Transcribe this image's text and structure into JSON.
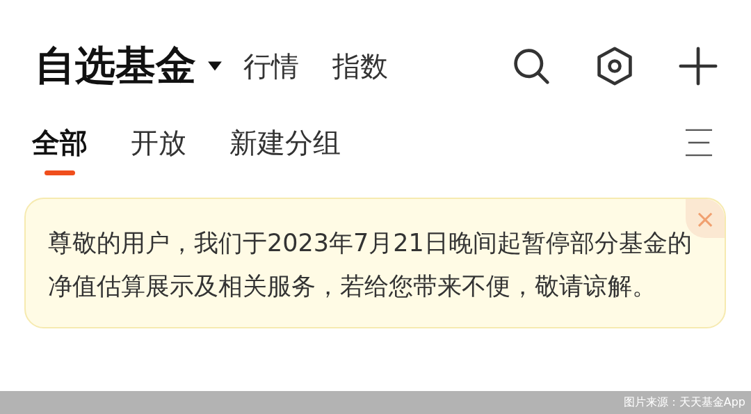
{
  "header": {
    "title": "自选基金",
    "nav": [
      {
        "label": "行情"
      },
      {
        "label": "指数"
      }
    ]
  },
  "tabs": [
    {
      "label": "全部",
      "selected": true
    },
    {
      "label": "开放",
      "selected": false
    },
    {
      "label": "新建分组",
      "selected": false
    }
  ],
  "notice": {
    "text": "尊敬的用户，我们于2023年7月21日晚间起暂停部分基金的净值估算展示及相关服务，若给您带来不便，敬请谅解。",
    "close": "×"
  },
  "caption": "图片来源：天天基金App"
}
